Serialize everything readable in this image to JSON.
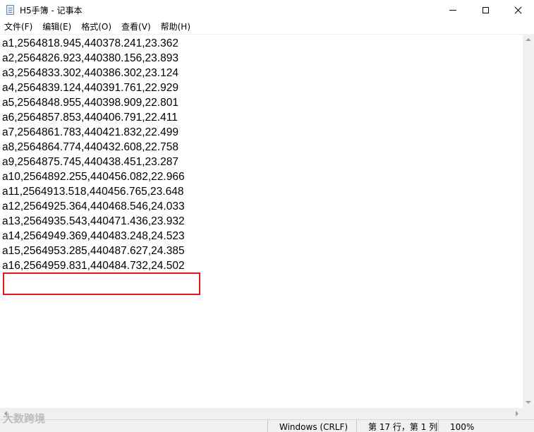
{
  "window": {
    "title": "H5手簿 - 记事本",
    "icon": "notepad-icon",
    "controls": {
      "minimize": "minimize-icon",
      "maximize": "maximize-icon",
      "close": "close-icon"
    }
  },
  "menu": {
    "items": [
      {
        "label": "文件(F)"
      },
      {
        "label": "编辑(E)"
      },
      {
        "label": "格式(O)"
      },
      {
        "label": "查看(V)"
      },
      {
        "label": "帮助(H)"
      }
    ]
  },
  "editor": {
    "lines": [
      "a1,2564818.945,440378.241,23.362",
      "a2,2564826.923,440380.156,23.893",
      "a3,2564833.302,440386.302,23.124",
      "a4,2564839.124,440391.761,22.929",
      "a5,2564848.955,440398.909,22.801",
      "a6,2564857.853,440406.791,22.411",
      "a7,2564861.783,440421.832,22.499",
      "a8,2564864.774,440432.608,22.758",
      "a9,2564875.745,440438.451,23.287",
      "a10,2564892.255,440456.082,22.966",
      "a11,2564913.518,440456.765,23.648",
      "a12,2564925.364,440468.546,24.033",
      "a13,2564935.543,440471.436,23.932",
      "a14,2564949.369,440483.248,24.523",
      "a15,2564953.285,440487.627,24.385",
      "a16,2564959.831,440484.732,24.502"
    ],
    "highlight_color": "#e1161b"
  },
  "status": {
    "encoding": "Windows (CRLF)",
    "position": "第 17 行，第 1 列",
    "zoom": "100%"
  },
  "watermark": "大数跨境"
}
